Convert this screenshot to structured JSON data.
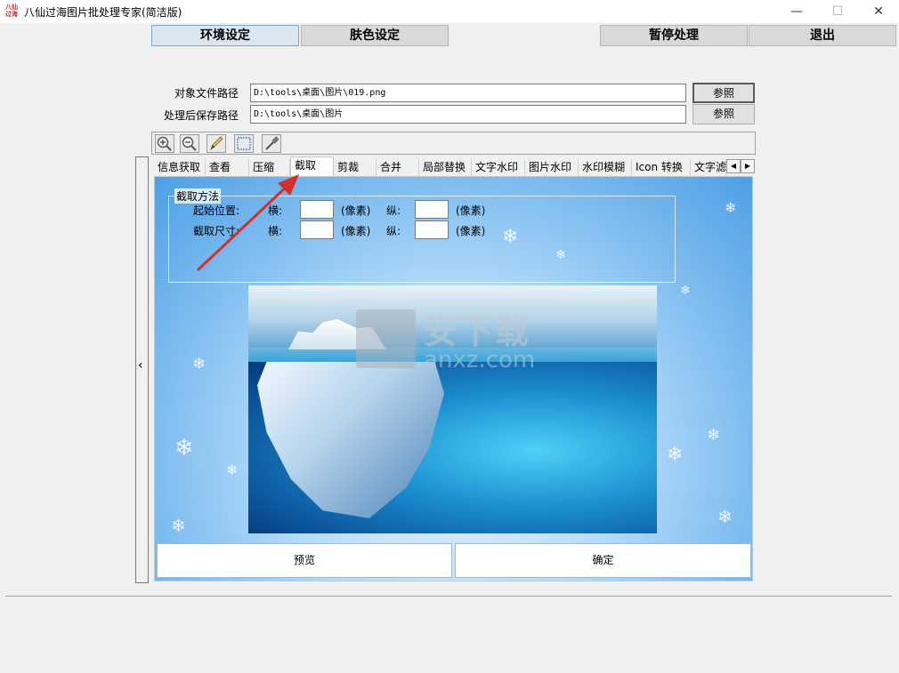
{
  "window": {
    "title": "八仙过海图片批处理专家(简洁版)",
    "icon_text": "八仙过海",
    "controls": {
      "minimize": "—",
      "maximize": "☐",
      "close": "✕"
    }
  },
  "top_buttons": {
    "env": "环境设定",
    "skin": "肤色设定",
    "pause": "暂停处理",
    "exit": "退出"
  },
  "paths": {
    "source_label": "对象文件路径",
    "source_value": "D:\\tools\\桌面\\图片\\019.png",
    "save_label": "处理后保存路径",
    "save_value": "D:\\tools\\桌面\\图片",
    "browse_label": "参照"
  },
  "toolbar": {
    "icons": [
      "zoom-in-icon",
      "zoom-out-icon",
      "pencil-icon",
      "select-rect-icon",
      "eyedropper-icon"
    ]
  },
  "side_panel": {
    "collapse_glyph": "‹"
  },
  "tabs": [
    "信息获取",
    "查看",
    "压缩",
    "截取",
    "剪裁",
    "合并",
    "局部替换",
    "文字水印",
    "图片水印",
    "水印模糊",
    "Icon 转换",
    "文字滤"
  ],
  "active_tab": "截取",
  "tab_scroll": {
    "left": "◀",
    "right": "▶"
  },
  "crop": {
    "group_title": "截取方法",
    "start_label": "起始位置:",
    "size_label": "截取尺寸:",
    "horizontal": "横:",
    "vertical": "纵:",
    "unit": "(像素)"
  },
  "watermark": {
    "cn": "安下载",
    "en": "anxz.com"
  },
  "bottom_buttons": {
    "preview": "预览",
    "confirm": "确定"
  },
  "colors": {
    "titlebar_bg": "#ffffff",
    "button_bg": "#d9d9d9",
    "arrow": "#d32f2f",
    "content_bg": "#7fbdf0"
  }
}
